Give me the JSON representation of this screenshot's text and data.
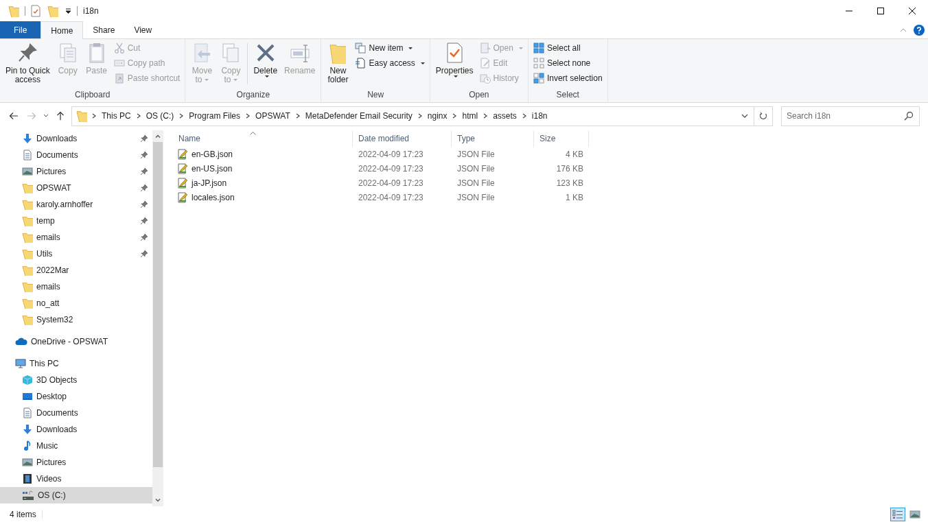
{
  "window": {
    "title": "i18n"
  },
  "ribbon": {
    "tabs": [
      {
        "label": "File",
        "kind": "file",
        "selected": false
      },
      {
        "label": "Home",
        "kind": "tab",
        "selected": true
      },
      {
        "label": "Share",
        "kind": "tab",
        "selected": false
      },
      {
        "label": "View",
        "kind": "tab",
        "selected": false
      }
    ],
    "groups": [
      {
        "label": "Clipboard",
        "items": [
          {
            "label": "Pin to Quick\naccess",
            "kind": "large",
            "disabled": false,
            "dropdown": false
          },
          {
            "label": "Copy",
            "kind": "large",
            "disabled": true,
            "dropdown": false
          },
          {
            "label": "Paste",
            "kind": "large",
            "disabled": true,
            "dropdown": false
          },
          {
            "label": "Cut",
            "kind": "small",
            "disabled": true,
            "dropdown": false
          },
          {
            "label": "Copy path",
            "kind": "small",
            "disabled": true,
            "dropdown": false
          },
          {
            "label": "Paste shortcut",
            "kind": "small",
            "disabled": true,
            "dropdown": false
          }
        ]
      },
      {
        "label": "Organize",
        "items": [
          {
            "label": "Move\nto",
            "kind": "large",
            "disabled": true,
            "dropdown": true
          },
          {
            "label": "Copy\nto",
            "kind": "large",
            "disabled": true,
            "dropdown": true
          },
          {
            "label": "Delete",
            "kind": "large",
            "disabled": false,
            "dropdown": true
          },
          {
            "label": "Rename",
            "kind": "large",
            "disabled": true,
            "dropdown": false
          }
        ]
      },
      {
        "label": "New",
        "items": [
          {
            "label": "New\nfolder",
            "kind": "large",
            "disabled": false,
            "dropdown": false
          },
          {
            "label": "New item",
            "kind": "small",
            "disabled": false,
            "dropdown": true
          },
          {
            "label": "Easy access",
            "kind": "small",
            "disabled": false,
            "dropdown": true
          }
        ]
      },
      {
        "label": "Open",
        "items": [
          {
            "label": "Properties",
            "kind": "large",
            "disabled": false,
            "dropdown": true
          },
          {
            "label": "Open",
            "kind": "small",
            "disabled": true,
            "dropdown": true
          },
          {
            "label": "Edit",
            "kind": "small",
            "disabled": true,
            "dropdown": false
          },
          {
            "label": "History",
            "kind": "small",
            "disabled": true,
            "dropdown": false
          }
        ]
      },
      {
        "label": "Select",
        "items": [
          {
            "label": "Select all",
            "kind": "small",
            "disabled": false,
            "dropdown": false
          },
          {
            "label": "Select none",
            "kind": "small",
            "disabled": false,
            "dropdown": false
          },
          {
            "label": "Invert selection",
            "kind": "small",
            "disabled": false,
            "dropdown": false
          }
        ]
      }
    ]
  },
  "address_bar": {
    "crumbs": [
      "This PC",
      "OS (C:)",
      "Program Files",
      "OPSWAT",
      "MetaDefender Email Security",
      "nginx",
      "html",
      "assets",
      "i18n"
    ]
  },
  "search": {
    "placeholder": "Search i18n"
  },
  "nav_tree": [
    {
      "children": [
        {
          "label": "Downloads",
          "kind": "downloads",
          "pinned": true,
          "selected": false
        },
        {
          "label": "Documents",
          "kind": "documents",
          "pinned": true,
          "selected": false
        },
        {
          "label": "Pictures",
          "kind": "pictures",
          "pinned": true,
          "selected": false
        },
        {
          "label": "OPSWAT",
          "kind": "folder",
          "pinned": true,
          "selected": false
        },
        {
          "label": "karoly.arnhoffer",
          "kind": "folder",
          "pinned": true,
          "selected": false
        },
        {
          "label": "temp",
          "kind": "folder",
          "pinned": true,
          "selected": false
        },
        {
          "label": "emails",
          "kind": "folder",
          "pinned": true,
          "selected": false
        },
        {
          "label": "Utils",
          "kind": "folder",
          "pinned": true,
          "selected": false
        },
        {
          "label": "2022Mar",
          "kind": "folder",
          "pinned": false,
          "selected": false
        },
        {
          "label": "emails",
          "kind": "folder",
          "pinned": false,
          "selected": false
        },
        {
          "label": "no_att",
          "kind": "folder",
          "pinned": false,
          "selected": false
        },
        {
          "label": "System32",
          "kind": "folder",
          "pinned": false,
          "selected": false
        }
      ]
    },
    {
      "label": "OneDrive - OPSWAT",
      "kind": "cloud",
      "pinned": false,
      "selected": false
    },
    {
      "label": "This PC",
      "kind": "pc",
      "pinned": false,
      "selected": false,
      "children": [
        {
          "label": "3D Objects",
          "kind": "objects3d",
          "pinned": false,
          "selected": false
        },
        {
          "label": "Desktop",
          "kind": "desktop",
          "pinned": false,
          "selected": false
        },
        {
          "label": "Documents",
          "kind": "documents",
          "pinned": false,
          "selected": false
        },
        {
          "label": "Downloads",
          "kind": "downloads",
          "pinned": false,
          "selected": false
        },
        {
          "label": "Music",
          "kind": "music",
          "pinned": false,
          "selected": false
        },
        {
          "label": "Pictures",
          "kind": "pictures",
          "pinned": false,
          "selected": false
        },
        {
          "label": "Videos",
          "kind": "videos",
          "pinned": false,
          "selected": false
        },
        {
          "label": "OS (C:)",
          "kind": "drive",
          "pinned": false,
          "selected": true
        }
      ]
    }
  ],
  "file_list": {
    "columns": [
      "Name",
      "Date modified",
      "Type",
      "Size"
    ],
    "rows": [
      {
        "name": "en-GB.json",
        "date_modified": "2022-04-09 17:23",
        "type": "JSON File",
        "size": "4 KB"
      },
      {
        "name": "en-US.json",
        "date_modified": "2022-04-09 17:23",
        "type": "JSON File",
        "size": "176 KB"
      },
      {
        "name": "ja-JP.json",
        "date_modified": "2022-04-09 17:23",
        "type": "JSON File",
        "size": "123 KB"
      },
      {
        "name": "locales.json",
        "date_modified": "2022-04-09 17:23",
        "type": "JSON File",
        "size": "1 KB"
      }
    ]
  },
  "status_bar": {
    "item_count": "4 items",
    "views": [
      {
        "kind": "details",
        "selected": true
      },
      {
        "kind": "large_icons",
        "selected": false
      }
    ]
  }
}
